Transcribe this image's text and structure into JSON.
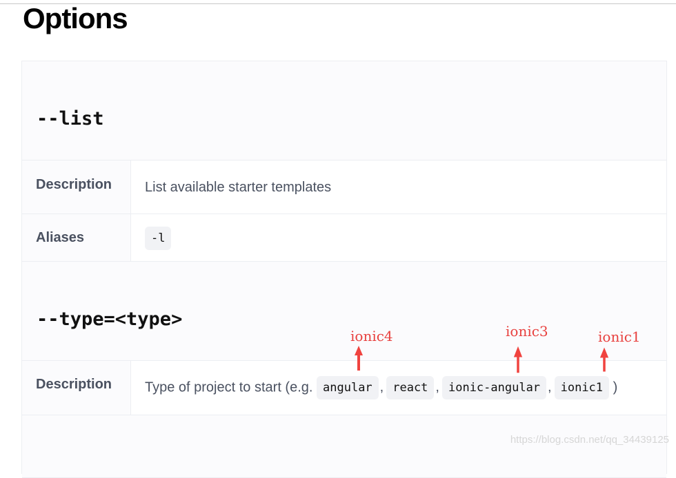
{
  "page": {
    "title": "Options"
  },
  "options": [
    {
      "name": "--list",
      "description_label": "Description",
      "description": "List available starter templates",
      "aliases_label": "Aliases",
      "alias": "-l"
    },
    {
      "name": "--type=<type>",
      "description_label": "Description",
      "description_prefix": "Type of project to start (e.g.",
      "types": [
        "angular",
        "react",
        "ionic-angular",
        "ionic1"
      ],
      "separator": ",",
      "description_suffix": ")"
    }
  ],
  "annotations": {
    "ionic4": "ionic4",
    "ionic3": "ionic3",
    "ionic1": "ionic1",
    "color": "#e8413f"
  },
  "watermark": "https://blog.csdn.net/qq_34439125"
}
